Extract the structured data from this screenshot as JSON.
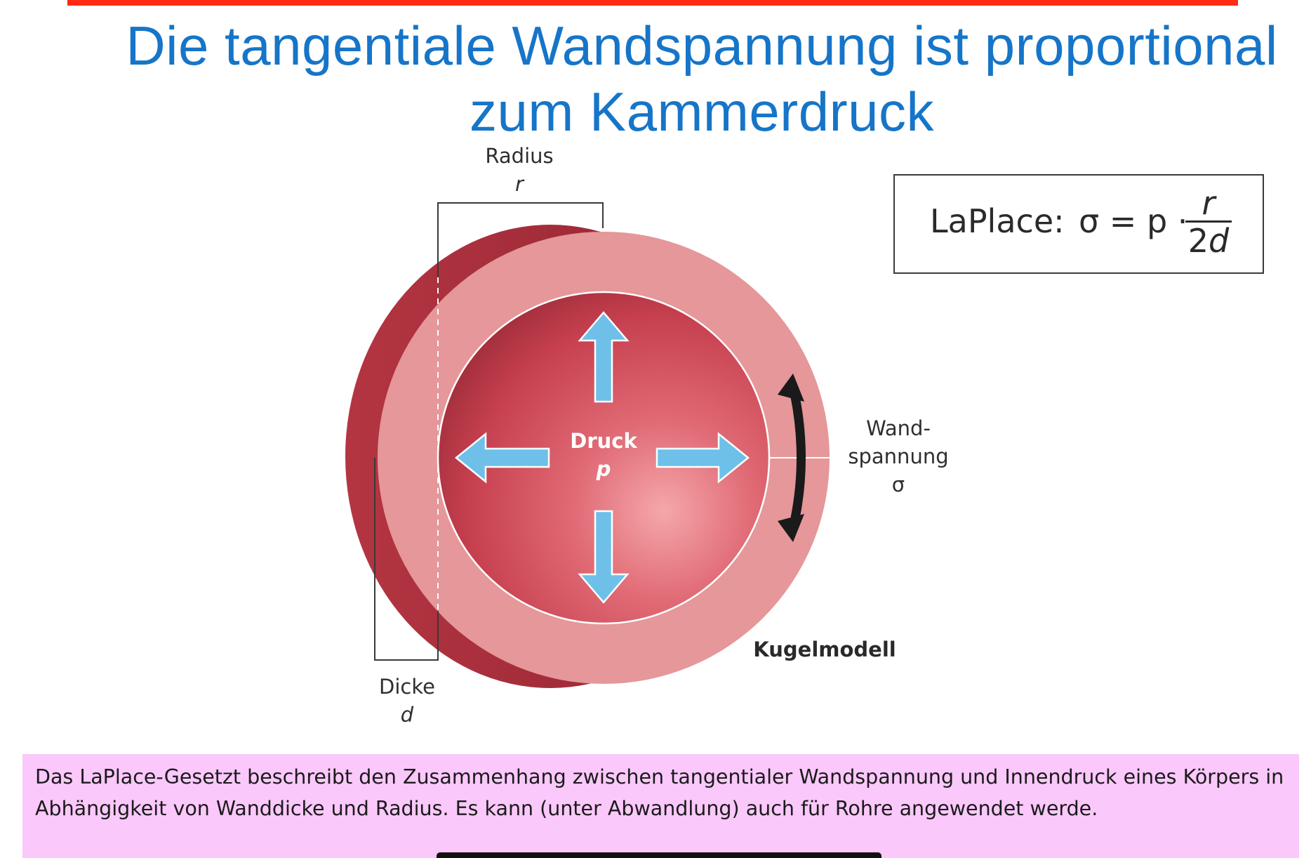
{
  "slide": {
    "title": "Die tangentiale Wandspannung ist proportional zum Kammerdruck",
    "colors": {
      "top_rule": "#ff2b14",
      "title": "#1675c8",
      "caption_background": "#fbc8fb",
      "arrow": "#6ec0e8",
      "wall_outer": "#e59799",
      "wall_dark": "#a9303c",
      "chamber": "#cf3f4f"
    }
  },
  "diagram": {
    "radius_label": "Radius",
    "radius_symbol": "r",
    "thickness_label": "Dicke",
    "thickness_symbol": "d",
    "pressure_label": "Druck",
    "pressure_symbol": "p",
    "wall_stress_label_line1": "Wand-",
    "wall_stress_label_line2": "spannung",
    "wall_stress_symbol": "σ",
    "model_label": "Kugelmodell",
    "icons": [
      "arrow-up-icon",
      "arrow-down-icon",
      "arrow-left-icon",
      "arrow-right-icon",
      "curved-double-arrow-icon"
    ]
  },
  "formula": {
    "name": "LaPlace:",
    "expression": "σ = p ·",
    "numerator": "r",
    "denominator_number": "2",
    "denominator_symbol": "d"
  },
  "caption": {
    "text": "Das LaPlace-Gesetzt beschreibt den Zusammenhang zwischen tangentialer Wandspannung und Innendruck eines Körpers in Abhängigkeit von Wanddicke und Radius. Es kann (unter Abwandlung) auch für Rohre angewendet werde."
  }
}
